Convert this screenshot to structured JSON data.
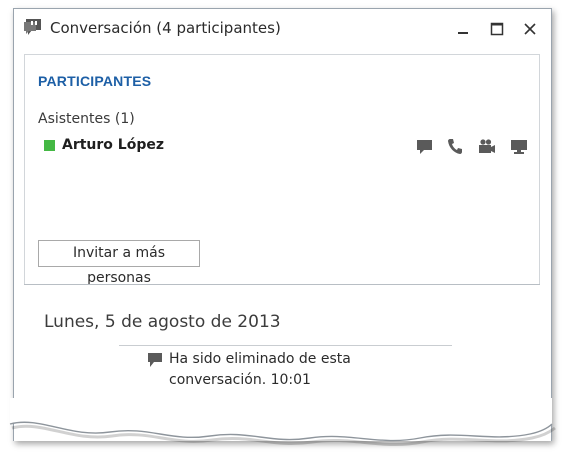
{
  "window": {
    "title": "Conversación (4 participantes)"
  },
  "participants": {
    "heading": "PARTICIPANTES",
    "group_label": "Asistentes (1)",
    "people": [
      {
        "name": "Arturo López",
        "presence": "available",
        "presence_color": "#44b844",
        "actions": [
          "im-icon",
          "phone-icon",
          "video-icon",
          "screen-share-icon"
        ]
      }
    ],
    "invite_label": "Invitar a más personas"
  },
  "conversation": {
    "date": "Lunes, 5 de agosto de 2013",
    "messages": [
      {
        "line1": "Ha sido eliminado de esta",
        "line2": "conversación. 10:01"
      }
    ]
  },
  "colors": {
    "accent": "#1d5fa6",
    "presence_available": "#44b844"
  }
}
